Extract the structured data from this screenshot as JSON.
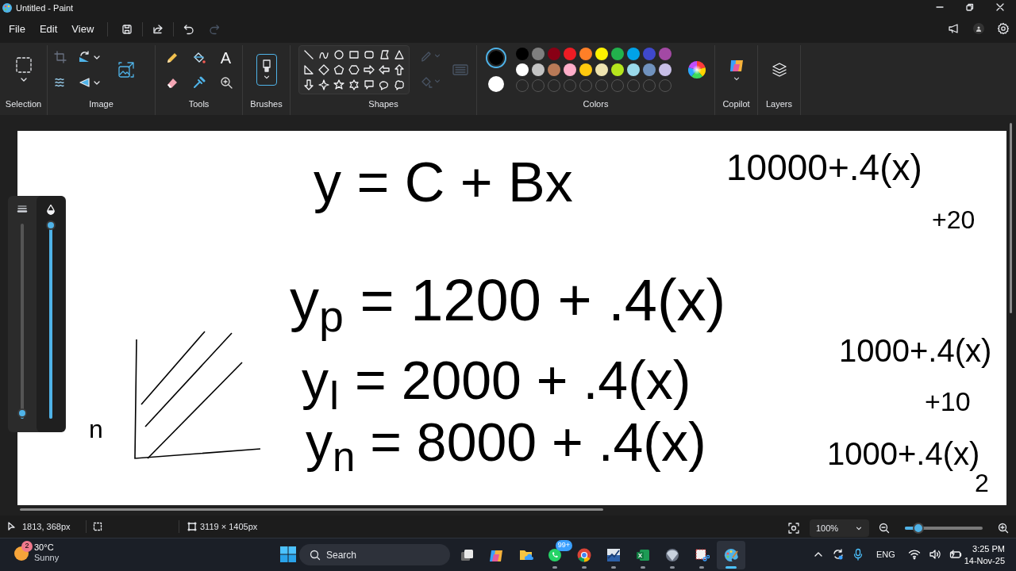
{
  "window": {
    "title": "Untitled - Paint"
  },
  "menu": [
    "File",
    "Edit",
    "View"
  ],
  "quick_actions": [
    {
      "kind": "save",
      "disabled": false
    },
    {
      "kind": "share",
      "disabled": false
    },
    {
      "kind": "undo",
      "disabled": false
    },
    {
      "kind": "redo",
      "disabled": true
    }
  ],
  "ribbon_groups": [
    "Selection",
    "Image",
    "Tools",
    "Brushes",
    "Shapes",
    "Colors",
    "Copilot",
    "Layers"
  ],
  "text_tool": "A",
  "colors": {
    "primary": {
      "color": "#000000"
    },
    "secondary": {
      "color": "#ffffff"
    },
    "palette": [
      {
        "color": "#000000"
      },
      {
        "color": "#7f7f7f"
      },
      {
        "color": "#880015"
      },
      {
        "color": "#ed1c24"
      },
      {
        "color": "#ff7f27"
      },
      {
        "color": "#fff200"
      },
      {
        "color": "#22b14c"
      },
      {
        "color": "#00a2e8"
      },
      {
        "color": "#3f48cc"
      },
      {
        "color": "#a349a4"
      },
      {
        "color": "#ffffff"
      },
      {
        "color": "#c3c3c3"
      },
      {
        "color": "#b97a57"
      },
      {
        "color": "#ffaec9"
      },
      {
        "color": "#ffc90e"
      },
      {
        "color": "#efe4b0"
      },
      {
        "color": "#b5e61d"
      },
      {
        "color": "#99d9ea"
      },
      {
        "color": "#7092be"
      },
      {
        "color": "#c8bfe7"
      }
    ]
  },
  "brush_sliders": [
    {
      "kind": "size",
      "level": 0.03
    },
    {
      "kind": "opacity",
      "level": 1
    }
  ],
  "canvas": {
    "notes": [
      {
        "text": "y = C + Bx"
      },
      {
        "text": "10000+.4(x)"
      },
      {
        "text": "+20"
      },
      {
        "text": "y$_{p}$ = 1200 + .4(x)"
      },
      {
        "text": "y$_{I}$ = 2000 + .4(x)"
      },
      {
        "text": "1000+.4(x)"
      },
      {
        "text": "+10"
      },
      {
        "text": "y$_{n}$ = 8000 + .4(x)"
      },
      {
        "text": "1000+.4(x)"
      },
      {
        "text": "2"
      },
      {
        "text": "n"
      }
    ]
  },
  "status_bar": {
    "cursor": "1813, 368px",
    "canvas_size": "3119 × 1405px",
    "zoom": "100%",
    "zoom_slider": {
      "level": 0.17
    }
  },
  "taskbar": {
    "weather": {
      "badge": "2",
      "temperature": "30°C",
      "condition": "Sunny"
    },
    "search": {
      "placeholder": "Search"
    },
    "apps": [
      {
        "kind": "taskview",
        "running": false,
        "selected": false
      },
      {
        "kind": "copilot",
        "running": false,
        "selected": false
      },
      {
        "kind": "folder",
        "running": false,
        "selected": false
      },
      {
        "kind": "chat",
        "running": true,
        "selected": false,
        "badge": "99+"
      },
      {
        "kind": "browser",
        "running": true,
        "selected": false
      },
      {
        "kind": "chart",
        "running": true,
        "selected": false
      },
      {
        "kind": "sheet",
        "running": true,
        "selected": false
      },
      {
        "kind": "sphere",
        "running": true,
        "selected": false
      },
      {
        "kind": "snip",
        "running": true,
        "selected": false
      },
      {
        "kind": "paint",
        "running": true,
        "selected": true
      }
    ],
    "language": "ENG",
    "time": "3:25 PM",
    "date": "14-Nov-25"
  }
}
